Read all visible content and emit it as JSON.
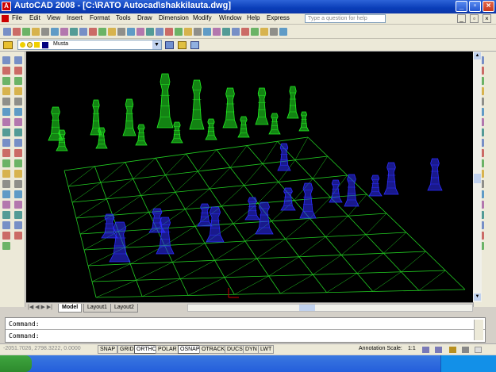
{
  "window": {
    "title": "AutoCAD 2008 - [C:\\RATO Autocad\\shakkilauta.dwg]",
    "help_placeholder": "Type a question for help"
  },
  "menu": {
    "items": [
      "File",
      "Edit",
      "View",
      "Insert",
      "Format",
      "Tools",
      "Draw",
      "Dimension",
      "Modify",
      "Window",
      "Help",
      "Express"
    ]
  },
  "layer": {
    "name": "Musta"
  },
  "tabs": [
    "Model",
    "Layout1",
    "Layout2"
  ],
  "command": {
    "line1": "Command:",
    "line2": "Command:"
  },
  "status": {
    "coords": "-2051.7026, 2798.3222, 0.0000",
    "toggles": [
      "SNAP",
      "GRID",
      "ORTHO",
      "POLAR",
      "OSNAP",
      "OTRACK",
      "DUCS",
      "DYN",
      "LWT"
    ],
    "annotation_scale_label": "Annotation Scale:",
    "annotation_scale_value": "1:1"
  },
  "colors": {
    "titlebar": "#0a3db8",
    "viewport": "#000000",
    "green_pieces": "#22ee22",
    "blue_pieces": "#2d2dff",
    "board_grid": "#22cc22"
  }
}
